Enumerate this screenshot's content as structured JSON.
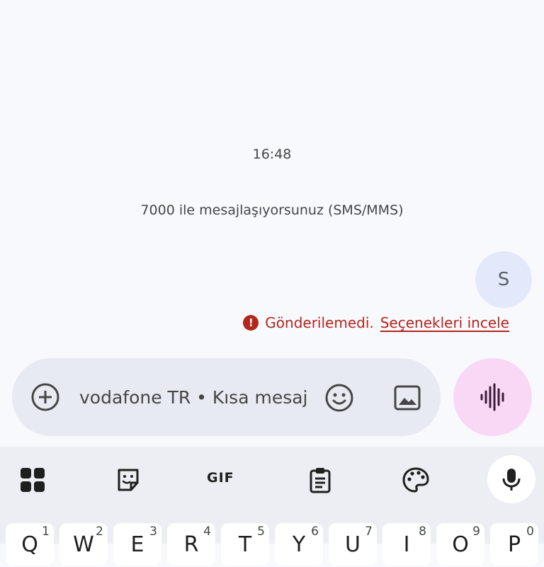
{
  "conversation": {
    "timestamp": "16:48",
    "info": "7000 ile mesajlaşıyorsunuz (SMS/MMS)",
    "bubble_letter": "S",
    "fail_text": "Gönderilemedi.",
    "fail_link": "Seçenekleri incele",
    "fail_icon_glyph": "!"
  },
  "composer": {
    "field_text": "vodafone TR • Kısa mesaj"
  },
  "keyboard": {
    "gif_label": "GIF",
    "keys": [
      {
        "label": "Q",
        "hint": "1"
      },
      {
        "label": "W",
        "hint": "2"
      },
      {
        "label": "E",
        "hint": "3"
      },
      {
        "label": "R",
        "hint": "4"
      },
      {
        "label": "T",
        "hint": "5"
      },
      {
        "label": "Y",
        "hint": "6"
      },
      {
        "label": "U",
        "hint": "7"
      },
      {
        "label": "I",
        "hint": "8"
      },
      {
        "label": "O",
        "hint": "9"
      },
      {
        "label": "P",
        "hint": "0"
      }
    ]
  },
  "colors": {
    "error": "#b3261e",
    "voice_button": "#f9d8f6",
    "bubble": "#e4e8fb"
  }
}
